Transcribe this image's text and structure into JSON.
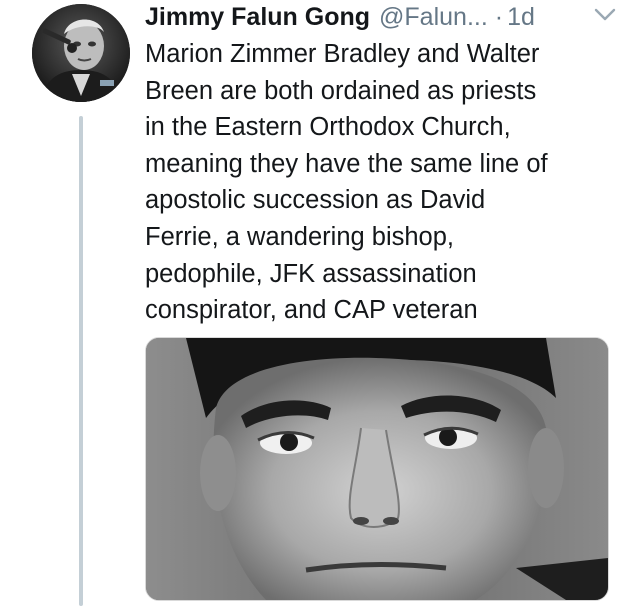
{
  "tweet": {
    "display_name": "Jimmy Falun Gong",
    "handle": "@Falun...",
    "separator": "·",
    "timestamp": "1d",
    "text": "Marion Zimmer Bradley and Walter\nBreen are both ordained as priests\nin the Eastern Orthodox Church,\nmeaning they have the same line of\napostolic succession as David\nFerrie, a wandering bishop,\npedophile, JFK assassination\nconspirator, and CAP veteran",
    "menu_icon": "chevron-down-icon",
    "avatar_icon": "profile-photo",
    "media_icon": "attached-photo"
  },
  "colors": {
    "text": "#14171a",
    "secondary": "#657786",
    "thread_line": "#c4cfd6"
  }
}
